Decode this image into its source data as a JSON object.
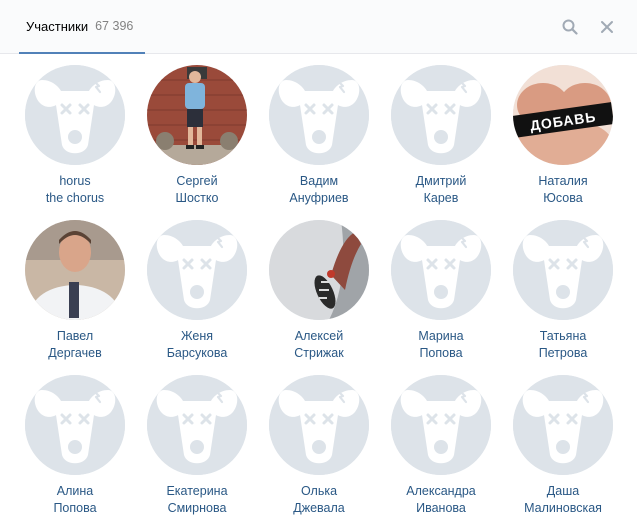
{
  "header": {
    "tab_label": "Участники",
    "tab_count": "67 396",
    "search_icon": "search-icon",
    "close_icon": "close-icon"
  },
  "members": [
    {
      "first": "horus",
      "last": "the chorus",
      "avatar": "default-avatar"
    },
    {
      "first": "Сергей",
      "last": "Шостко",
      "avatar": "photo-man-brick-wall"
    },
    {
      "first": "Вадим",
      "last": "Ануфриев",
      "avatar": "default-avatar"
    },
    {
      "first": "Дмитрий",
      "last": "Карев",
      "avatar": "default-avatar"
    },
    {
      "first": "Наталия",
      "last": "Юсова",
      "avatar": "photo-dobav",
      "avatar_text": "ДОБАВЬ"
    },
    {
      "first": "Павел",
      "last": "Дергачев",
      "avatar": "photo-man-tie"
    },
    {
      "first": "Женя",
      "last": "Барсукова",
      "avatar": "default-avatar"
    },
    {
      "first": "Алексей",
      "last": "Стрижак",
      "avatar": "photo-woodpecker"
    },
    {
      "first": "Марина",
      "last": "Попова",
      "avatar": "default-avatar"
    },
    {
      "first": "Татьяна",
      "last": "Петрова",
      "avatar": "default-avatar"
    },
    {
      "first": "Алина",
      "last": "Попова",
      "avatar": "default-avatar"
    },
    {
      "first": "Екатерина",
      "last": "Смирнова",
      "avatar": "default-avatar"
    },
    {
      "first": "Олька",
      "last": "Джевала",
      "avatar": "default-avatar"
    },
    {
      "first": "Александра",
      "last": "Иванова",
      "avatar": "default-avatar"
    },
    {
      "first": "Даша",
      "last": "Малиновская",
      "avatar": "default-avatar"
    }
  ],
  "colors": {
    "link": "#2a5885",
    "tab_underline": "#5181b8",
    "avatar_bg": "#dde3e9",
    "icon": "#a1aab5"
  }
}
